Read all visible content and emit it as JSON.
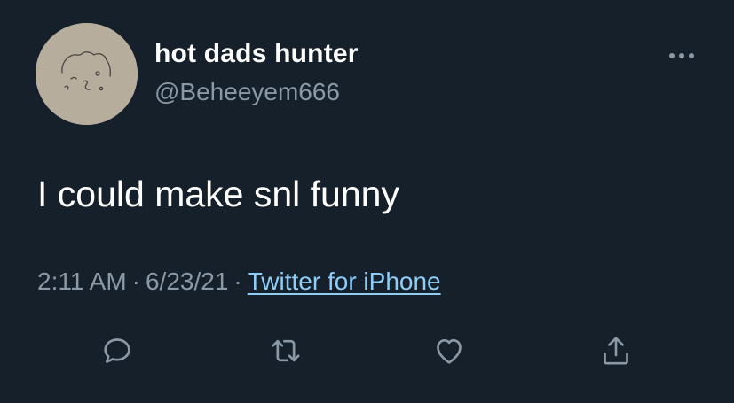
{
  "tweet": {
    "author": {
      "display_name": "hot dads hunter",
      "handle": "@Beheeyem666",
      "avatar_icon": "sketch-face-avatar"
    },
    "text": "I could make snl funny",
    "time": "2:11 AM",
    "separator": "·",
    "date": "6/23/21",
    "source": "Twitter for iPhone"
  },
  "actions": [
    {
      "name": "reply",
      "icon": "speech-bubble-icon"
    },
    {
      "name": "retweet",
      "icon": "retweet-icon"
    },
    {
      "name": "like",
      "icon": "heart-icon"
    },
    {
      "name": "share",
      "icon": "share-icon"
    }
  ],
  "menu": {
    "icon": "more-options-icon"
  },
  "colors": {
    "background": "#15202b",
    "primary_text": "#ffffff",
    "secondary_text": "#8b98a5",
    "link": "#8ecdf8"
  }
}
